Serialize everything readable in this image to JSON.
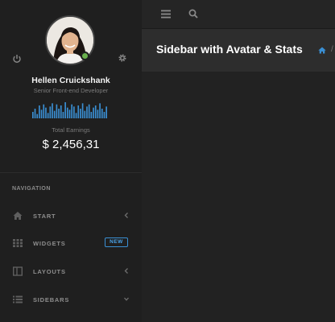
{
  "profile": {
    "name": "Hellen Cruickshank",
    "role": "Senior Front-end Developer",
    "status": "online",
    "earnings_label": "Total Earnings",
    "earnings_value": "$ 2,456,31",
    "sparkline": [
      6,
      9,
      4,
      12,
      8,
      13,
      10,
      5,
      11,
      14,
      7,
      13,
      9,
      12,
      6,
      15,
      10,
      8,
      13,
      11,
      5,
      12,
      9,
      14,
      7,
      11,
      13,
      6,
      10,
      12,
      8,
      14,
      9,
      6,
      11
    ]
  },
  "navigation": {
    "heading": "NAVIGATION",
    "items": [
      {
        "label": "START",
        "icon": "home-icon",
        "chevron": "left"
      },
      {
        "label": "WIDGETS",
        "icon": "grid-icon",
        "badge": "NEW"
      },
      {
        "label": "LAYOUTS",
        "icon": "columns-icon",
        "chevron": "left"
      },
      {
        "label": "SIDEBARS",
        "icon": "list-icon",
        "chevron": "down"
      }
    ]
  },
  "header": {
    "title": "Sidebar with Avatar & Stats",
    "breadcrumb_separator": "/"
  },
  "colors": {
    "accent": "#3a8fd3",
    "status_online": "#6ab04c",
    "sidebar_bg": "#1f1f1f",
    "page_bg": "#222222"
  }
}
